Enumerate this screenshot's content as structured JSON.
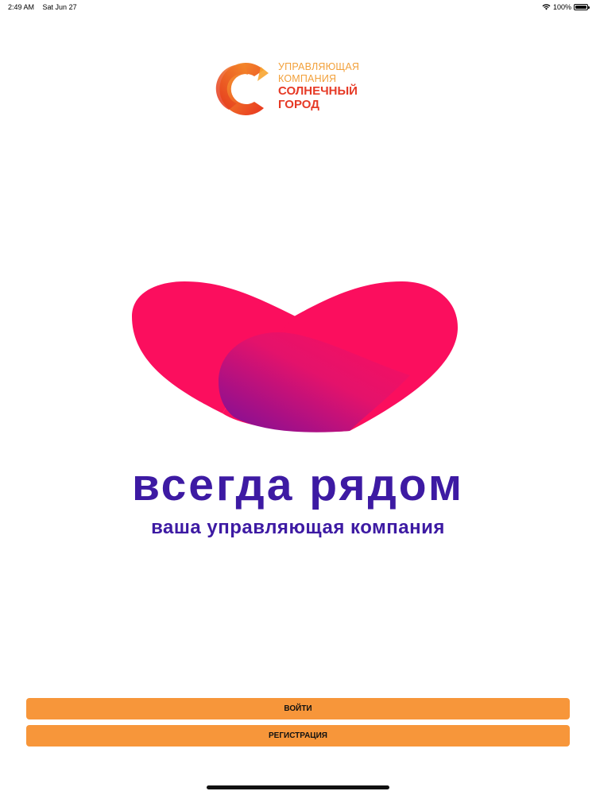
{
  "status_bar": {
    "time": "2:49 AM",
    "date": "Sat Jun 27",
    "battery_text": "100%",
    "battery_level": 1.0
  },
  "logo": {
    "line1": "УПРАВЛЯЮЩАЯ",
    "line2": "КОМПАНИЯ",
    "line3": "СОЛНЕЧНЫЙ",
    "line4": "ГОРОД"
  },
  "slogan": {
    "title": "всегда рядом",
    "subtitle": "ваша управляющая компания"
  },
  "buttons": {
    "login_label": "ВОЙТИ",
    "register_label": "РЕГИСТРАЦИЯ"
  },
  "colors": {
    "accent_orange": "#f7963a",
    "logo_orange": "#f2a03a",
    "logo_red": "#e63a26",
    "heart_pink": "#fb0e5e",
    "heart_purple": "#8a0f95",
    "slogan_purple": "#3d1aa3"
  },
  "icons": {
    "wifi": "wifi-icon",
    "battery": "battery-icon"
  }
}
